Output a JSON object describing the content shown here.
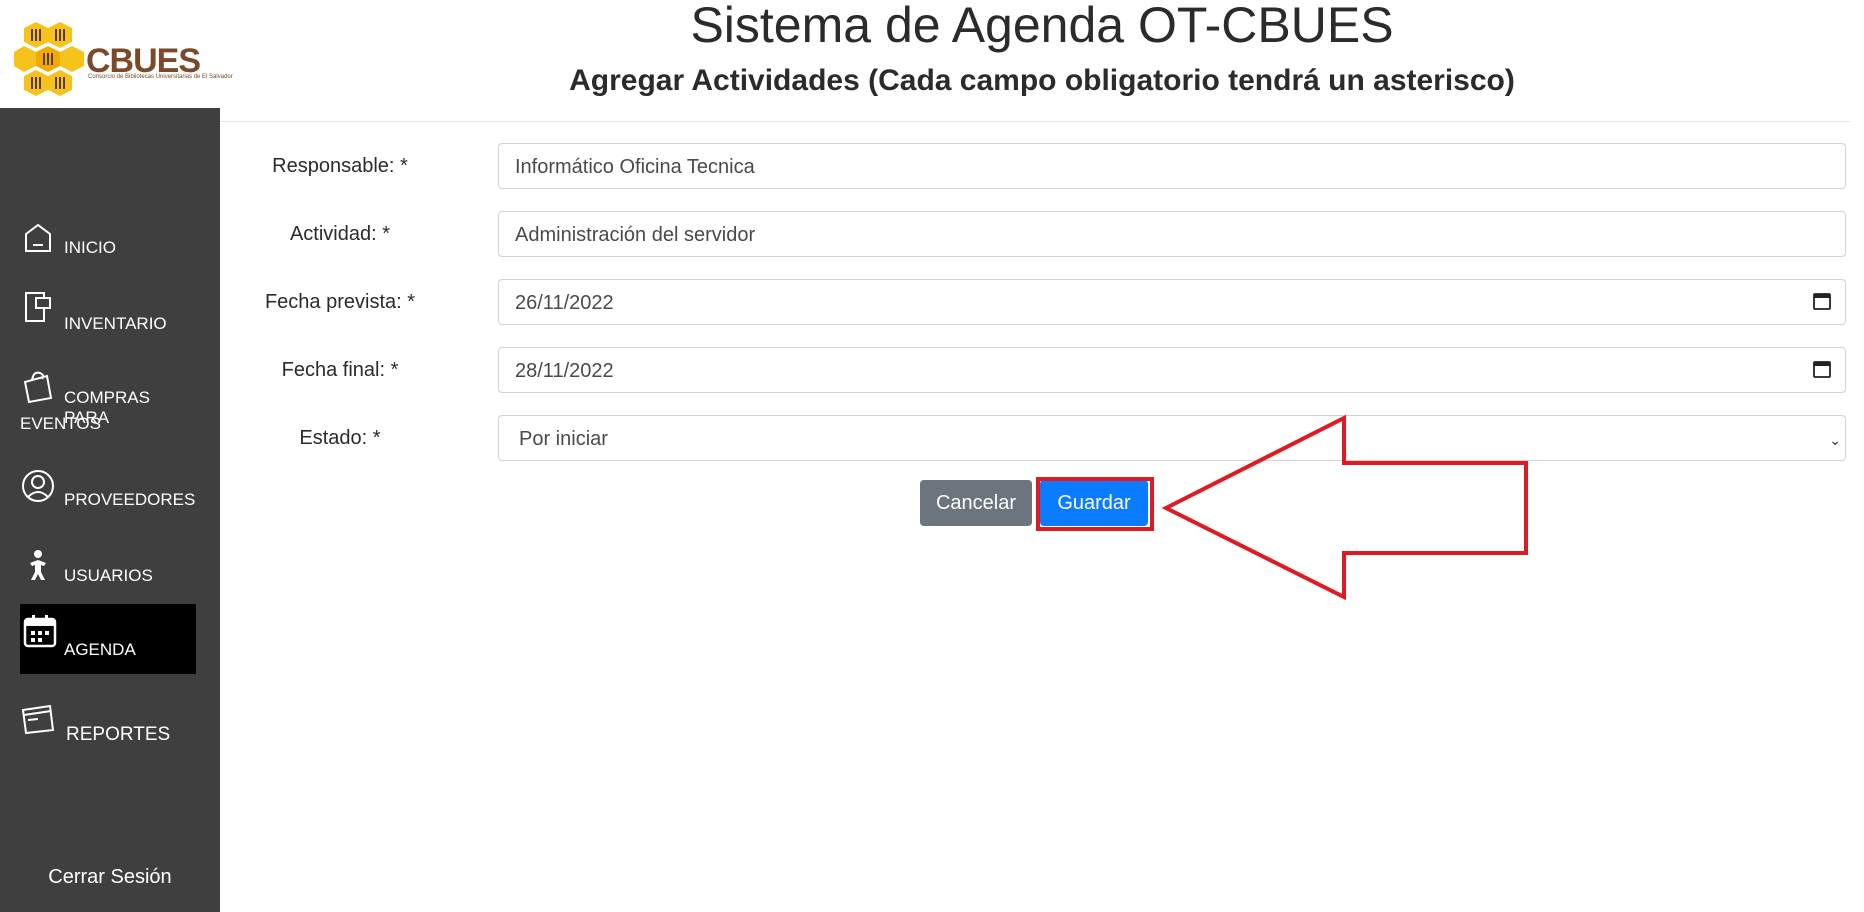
{
  "brand": {
    "name": "CBUES",
    "tagline": "Consorcio de Bibliotecas Universitarias de El Salvador"
  },
  "header": {
    "title": "Sistema de Agenda OT-CBUES",
    "subtitle": "Agregar Actividades (Cada campo obligatorio tendrá un asterisco)"
  },
  "sidebar": {
    "items": [
      {
        "label": "INICIO",
        "icon": "home-icon"
      },
      {
        "label": "INVENTARIO",
        "icon": "inventory-icon"
      },
      {
        "label": "COMPRAS PARA",
        "label2": "EVENTOS",
        "icon": "shopping-bag-icon"
      },
      {
        "label": "PROVEEDORES",
        "icon": "user-circle-icon"
      },
      {
        "label": "USUARIOS",
        "icon": "person-icon"
      },
      {
        "label": "AGENDA",
        "icon": "calendar-icon",
        "active": true
      },
      {
        "label": "REPORTES",
        "icon": "reports-icon"
      }
    ],
    "logout": "Cerrar Sesión"
  },
  "form": {
    "responsable": {
      "label": "Responsable: *",
      "value": "Informático Oficina Tecnica"
    },
    "actividad": {
      "label": "Actividad: *",
      "value": "Administración del servidor"
    },
    "fecha_prevista": {
      "label": "Fecha prevista: *",
      "value": "26/11/2022"
    },
    "fecha_final": {
      "label": "Fecha final: *",
      "value": "28/11/2022"
    },
    "estado": {
      "label": "Estado: *",
      "value": "Por iniciar"
    },
    "cancel_label": "Cancelar",
    "save_label": "Guardar"
  },
  "colors": {
    "sidebar": "#3f3f3f",
    "active": "#000000",
    "primary": "#0b7bff",
    "secondary": "#6c757d",
    "annotation": "#e01a22"
  }
}
